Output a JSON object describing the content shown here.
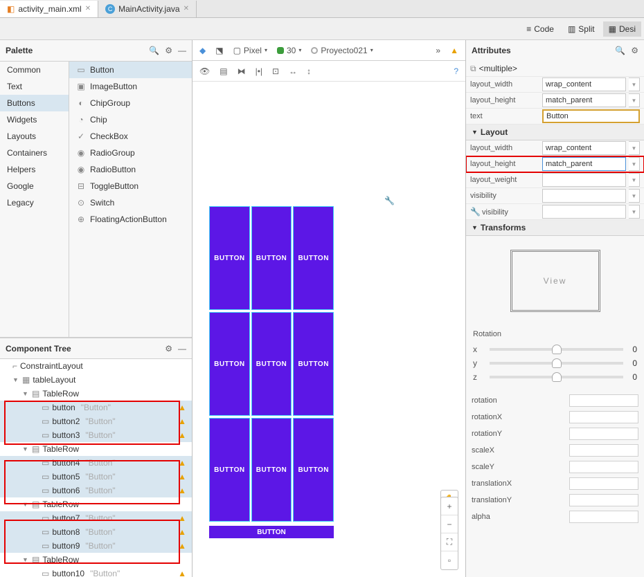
{
  "tabs": [
    {
      "label": "activity_main.xml",
      "active": true
    },
    {
      "label": "MainActivity.java",
      "active": false
    }
  ],
  "modes": [
    {
      "label": "Code"
    },
    {
      "label": "Split"
    },
    {
      "label": "Desi"
    }
  ],
  "palette": {
    "title": "Palette",
    "categories": [
      "Common",
      "Text",
      "Buttons",
      "Widgets",
      "Layouts",
      "Containers",
      "Helpers",
      "Google",
      "Legacy"
    ],
    "selected_category": "Buttons",
    "items": [
      "Button",
      "ImageButton",
      "ChipGroup",
      "Chip",
      "CheckBox",
      "RadioGroup",
      "RadioButton",
      "ToggleButton",
      "Switch",
      "FloatingActionButton"
    ],
    "selected_item": "Button"
  },
  "component_tree": {
    "title": "Component Tree",
    "root": "ConstraintLayout",
    "table": "tableLayout",
    "row_label": "TableRow",
    "buttons": [
      "button",
      "button2",
      "button3",
      "button4",
      "button5",
      "button6",
      "button7",
      "button8",
      "button9",
      "button10"
    ],
    "hint": "\"Button\""
  },
  "design_toolbar": {
    "device": "Pixel",
    "api": "30",
    "project": "Proyecto021"
  },
  "canvas": {
    "button_label": "BUTTON"
  },
  "attributes": {
    "title": "Attributes",
    "selection": "<multiple>",
    "top": [
      {
        "label": "layout_width",
        "value": "wrap_content"
      },
      {
        "label": "layout_height",
        "value": "match_parent"
      },
      {
        "label": "text",
        "value": "Button",
        "gold": true
      }
    ],
    "layout_section": "Layout",
    "layout": [
      {
        "label": "layout_width",
        "value": "wrap_content"
      },
      {
        "label": "layout_height",
        "value": "match_parent",
        "highlight": true
      },
      {
        "label": "layout_weight",
        "value": ""
      },
      {
        "label": "visibility",
        "value": ""
      },
      {
        "label": "visibility",
        "value": "",
        "wrench": true
      }
    ],
    "transforms_section": "Transforms",
    "view_label": "View",
    "rotation_header": "Rotation",
    "rotation": [
      {
        "label": "x",
        "value": "0"
      },
      {
        "label": "y",
        "value": "0"
      },
      {
        "label": "z",
        "value": "0"
      }
    ],
    "fields": [
      "rotation",
      "rotationX",
      "rotationY",
      "scaleX",
      "scaleY",
      "translationX",
      "translationY",
      "alpha"
    ]
  }
}
